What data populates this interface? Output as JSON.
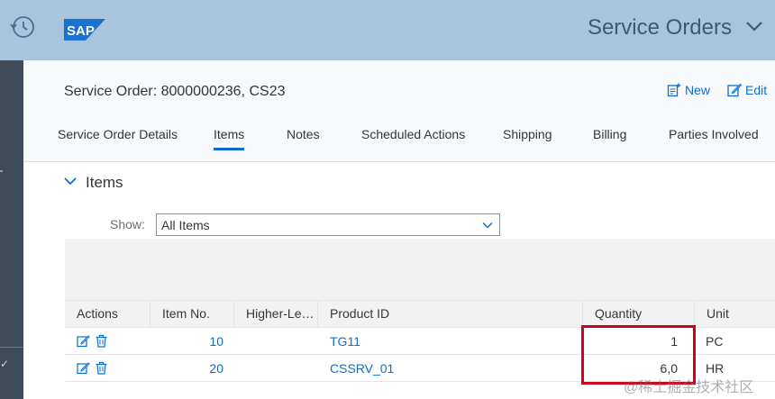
{
  "shell": {
    "brand": "SAP",
    "app_title": "Service Orders",
    "history_icon": "history-icon",
    "menu_icon": "chevron-down-icon"
  },
  "header": {
    "title": "Service Order: 8000000236, CS23",
    "new_label": "New",
    "edit_label": "Edit"
  },
  "tabs": [
    {
      "label": "Service Order Details",
      "selected": false
    },
    {
      "label": "Items",
      "selected": true
    },
    {
      "label": "Notes",
      "selected": false
    },
    {
      "label": "Scheduled Actions",
      "selected": false
    },
    {
      "label": "Shipping",
      "selected": false
    },
    {
      "label": "Billing",
      "selected": false
    },
    {
      "label": "Parties Involved",
      "selected": false
    }
  ],
  "section": {
    "title": "Items",
    "show_label": "Show:",
    "show_value": "All Items"
  },
  "table": {
    "columns": [
      "Actions",
      "Item No.",
      "Higher-Le…",
      "Product ID",
      "Quantity",
      "Unit"
    ],
    "rows": [
      {
        "item_no": "10",
        "higher_level": "",
        "product_id": "TG11",
        "quantity": "1",
        "unit": "PC"
      },
      {
        "item_no": "20",
        "higher_level": "",
        "product_id": "CSSRV_01",
        "quantity": "6,0",
        "unit": "HR"
      }
    ]
  },
  "colors": {
    "shell_bg": "#a9c5de",
    "accent": "#0a6ed1",
    "highlight": "#d0021b"
  },
  "watermark": "@稀土掘金技术社区"
}
